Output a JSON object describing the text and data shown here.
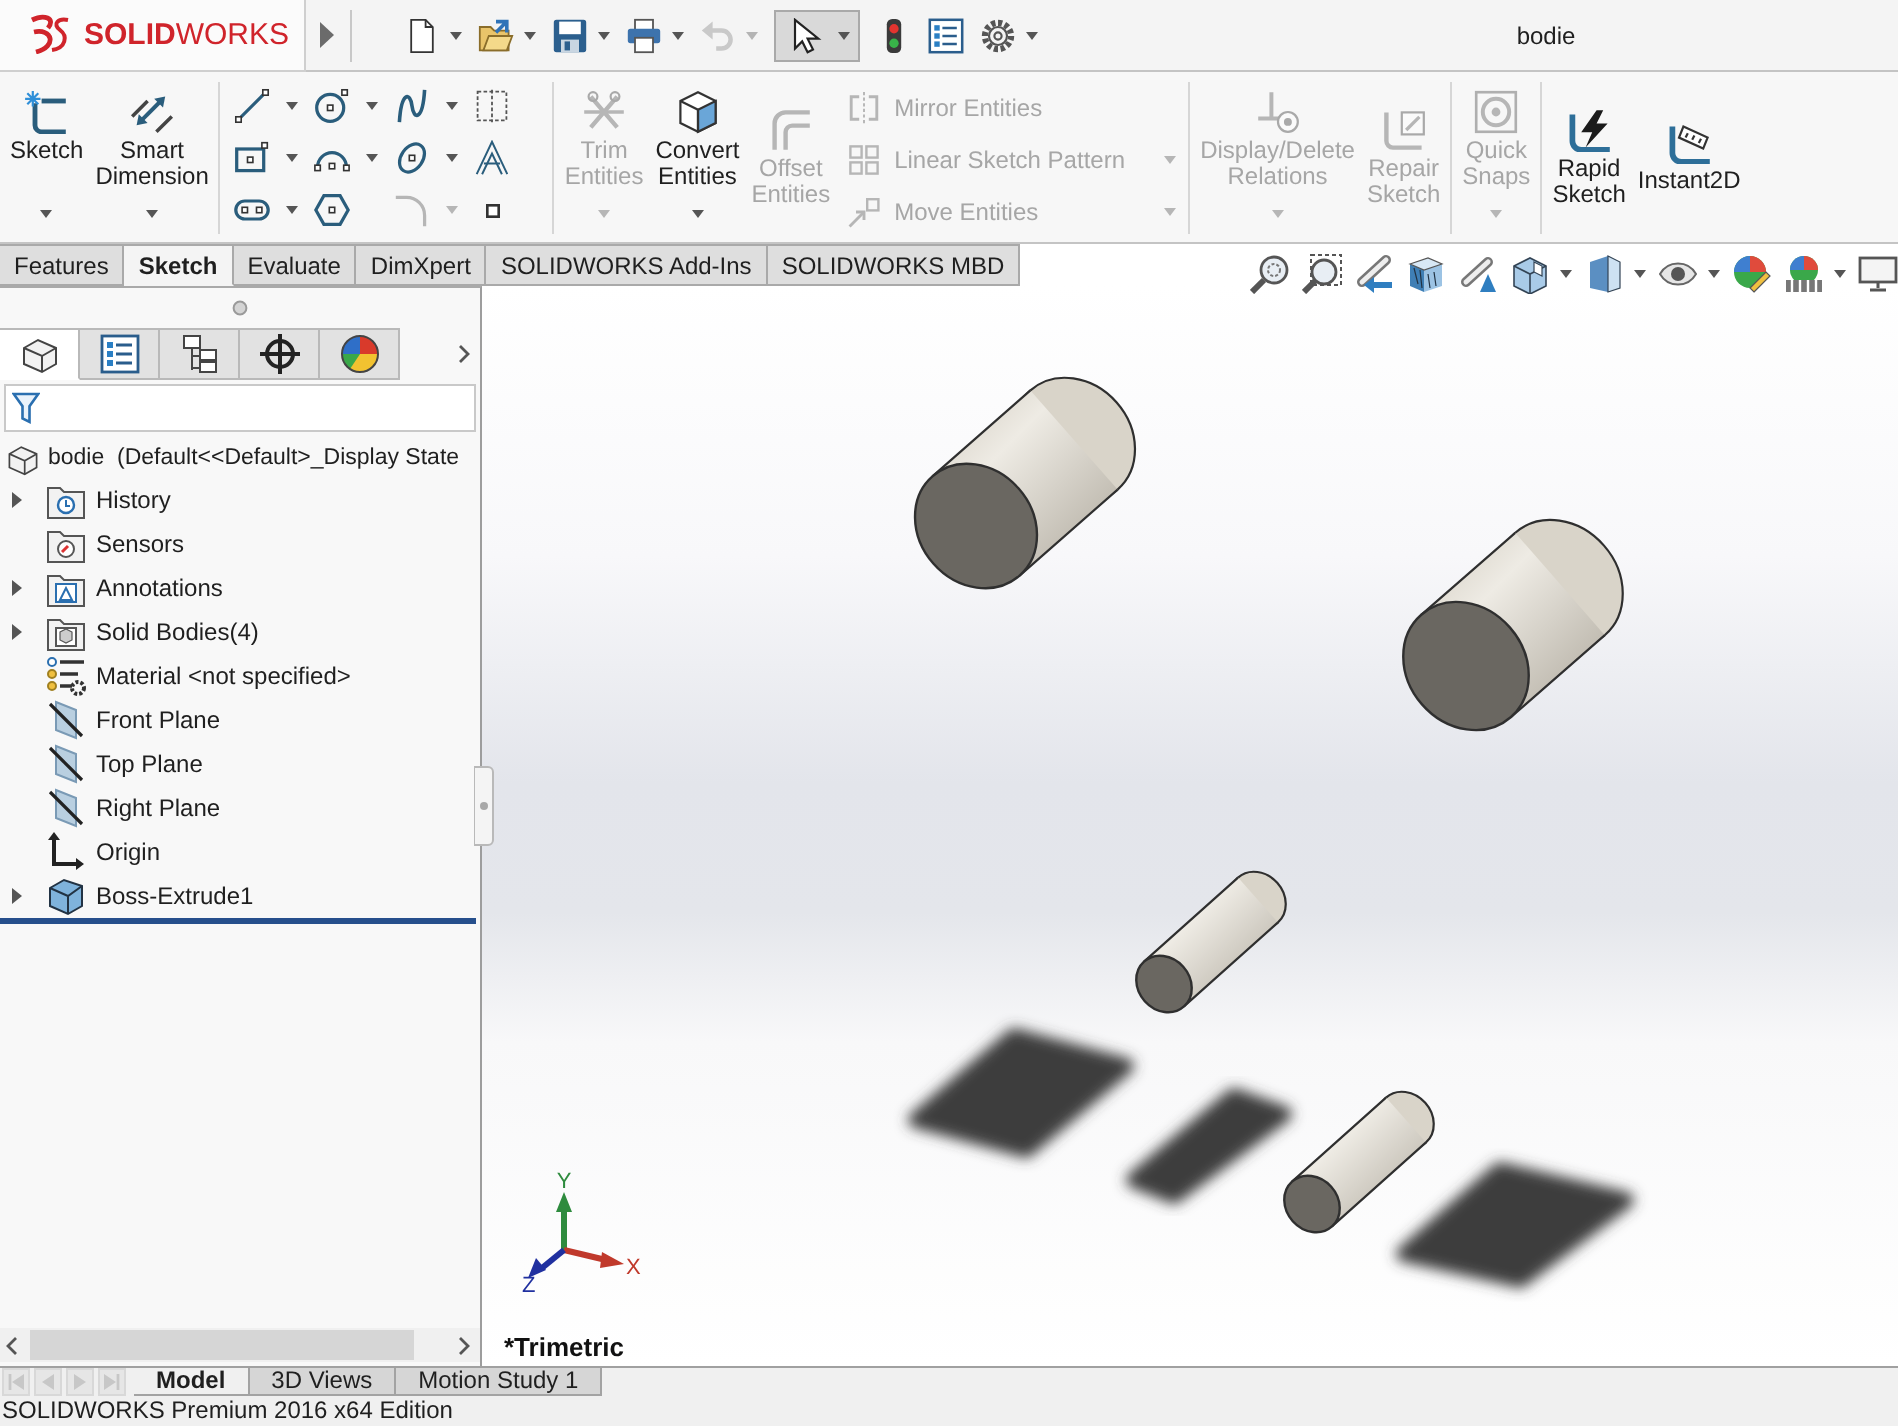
{
  "title_bar": {
    "logo": "**SOLID**WORKS",
    "quick_access": [
      {
        "kind": "new",
        "dropdown": true,
        "disabled": false,
        "pressed": false
      },
      {
        "kind": "open",
        "dropdown": true,
        "disabled": false,
        "pressed": false
      },
      {
        "kind": "save",
        "dropdown": true,
        "disabled": false,
        "pressed": false
      },
      {
        "kind": "print",
        "dropdown": true,
        "disabled": false,
        "pressed": false
      },
      {
        "kind": "undo",
        "dropdown": true,
        "disabled": true,
        "pressed": false
      },
      {
        "kind": "select",
        "dropdown": true,
        "disabled": false,
        "pressed": true
      },
      {
        "kind": "rebuild",
        "dropdown": false,
        "disabled": false,
        "pressed": false
      },
      {
        "kind": "file-properties",
        "dropdown": false,
        "disabled": false,
        "pressed": false
      },
      {
        "kind": "options",
        "dropdown": true,
        "disabled": false,
        "pressed": false
      }
    ],
    "document_title": "bodie"
  },
  "ribbon": {
    "groups": [
      {
        "buttons": [
          {
            "kind": "sketch",
            "label": "Sketch",
            "dropdown": true,
            "disabled": false
          },
          {
            "kind": "smart-dimension",
            "label": "Smart Dimension",
            "dropdown": true,
            "disabled": false
          }
        ]
      },
      {
        "grid": [
          {
            "kind": "line",
            "dropdown": true,
            "disabled": false
          },
          {
            "kind": "circle",
            "dropdown": true,
            "disabled": false
          },
          {
            "kind": "spline",
            "dropdown": true,
            "disabled": false
          },
          {
            "kind": "construction",
            "dropdown": false,
            "disabled": false
          },
          {
            "kind": "rectangle",
            "dropdown": true,
            "disabled": false
          },
          {
            "kind": "arc",
            "dropdown": true,
            "disabled": false
          },
          {
            "kind": "ellipse",
            "dropdown": true,
            "disabled": false
          },
          {
            "kind": "text",
            "dropdown": false,
            "disabled": false
          },
          {
            "kind": "slot",
            "dropdown": true,
            "disabled": false
          },
          {
            "kind": "polygon",
            "dropdown": false,
            "disabled": false
          },
          {
            "kind": "fillet",
            "dropdown": true,
            "disabled": true
          },
          {
            "kind": "point",
            "dropdown": false,
            "disabled": false
          }
        ]
      },
      {
        "buttons": [
          {
            "kind": "trim-entities",
            "label": "Trim Entities",
            "dropdown": true,
            "disabled": true
          },
          {
            "kind": "convert-entities",
            "label": "Convert Entities",
            "dropdown": true,
            "disabled": false
          },
          {
            "kind": "offset-entities",
            "label": "Offset Entities",
            "dropdown": false,
            "disabled": true
          }
        ],
        "list": [
          {
            "kind": "mirror-entities",
            "label": "Mirror Entities",
            "dropdown": false,
            "disabled": true
          },
          {
            "kind": "linear-sketch-pattern",
            "label": "Linear Sketch Pattern",
            "dropdown": true,
            "disabled": true
          },
          {
            "kind": "move-entities",
            "label": "Move Entities",
            "dropdown": true,
            "disabled": true
          }
        ]
      },
      {
        "buttons": [
          {
            "kind": "display-delete-relations",
            "label": "Display/Delete Relations",
            "dropdown": true,
            "disabled": true
          },
          {
            "kind": "repair-sketch",
            "label": "Repair Sketch",
            "dropdown": false,
            "disabled": true
          }
        ]
      },
      {
        "buttons": [
          {
            "kind": "quick-snaps",
            "label": "Quick Snaps",
            "dropdown": true,
            "disabled": true
          }
        ]
      },
      {
        "buttons": [
          {
            "kind": "rapid-sketch",
            "label": "Rapid Sketch",
            "dropdown": false,
            "disabled": false
          },
          {
            "kind": "instant2d",
            "label": "Instant2D",
            "dropdown": false,
            "disabled": false
          }
        ]
      }
    ]
  },
  "command_tabs": [
    {
      "label": "Features",
      "selected": false
    },
    {
      "label": "Sketch",
      "selected": true
    },
    {
      "label": "Evaluate",
      "selected": false
    },
    {
      "label": "DimXpert",
      "selected": false
    },
    {
      "label": "SOLIDWORKS Add-Ins",
      "selected": false
    },
    {
      "label": "SOLIDWORKS MBD",
      "selected": false
    }
  ],
  "view_toolbar": [
    {
      "kind": "zoom-to-fit",
      "dropdown": false
    },
    {
      "kind": "zoom-to-area",
      "dropdown": false
    },
    {
      "kind": "previous-view",
      "dropdown": false
    },
    {
      "kind": "section-view",
      "dropdown": false
    },
    {
      "kind": "dynamic-annotation",
      "dropdown": false
    },
    {
      "kind": "view-orientation",
      "dropdown": true
    },
    {
      "kind": "display-style",
      "dropdown": true
    },
    {
      "kind": "hide-show",
      "dropdown": true
    },
    {
      "kind": "edit-appearance",
      "dropdown": false
    },
    {
      "kind": "apply-scene",
      "dropdown": true
    },
    {
      "kind": "view-settings",
      "dropdown": false
    }
  ],
  "manager_tabs": [
    {
      "kind": "feature-manager",
      "selected": true
    },
    {
      "kind": "property-manager",
      "selected": false
    },
    {
      "kind": "configuration-manager",
      "selected": false
    },
    {
      "kind": "dimxpert-manager",
      "selected": false
    },
    {
      "kind": "display-manager",
      "selected": false
    }
  ],
  "feature_tree": {
    "root": {
      "kind": "part",
      "label": "bodie  (Default<<Default>_Display State",
      "children": [
        {
          "kind": "history",
          "label": "History",
          "expandable": true
        },
        {
          "kind": "sensors",
          "label": "Sensors",
          "expandable": false
        },
        {
          "kind": "annotations",
          "label": "Annotations",
          "expandable": true
        },
        {
          "kind": "solid-bodies",
          "label": "Solid Bodies(4)",
          "expandable": true
        },
        {
          "kind": "material",
          "label": "Material <not specified>",
          "expandable": false
        },
        {
          "kind": "plane",
          "label": "Front Plane",
          "expandable": false
        },
        {
          "kind": "plane",
          "label": "Top Plane",
          "expandable": false
        },
        {
          "kind": "plane",
          "label": "Right Plane",
          "expandable": false
        },
        {
          "kind": "origin",
          "label": "Origin",
          "expandable": false
        },
        {
          "kind": "extrude",
          "label": "Boss-Extrude1",
          "expandable": true
        }
      ]
    }
  },
  "viewport": {
    "view_name": "*Trimetric",
    "triad": {
      "x": "X",
      "y": "Y",
      "z": "Z"
    }
  },
  "bottom_tabs": {
    "navigation": [
      {
        "kind": "first",
        "disabled": true
      },
      {
        "kind": "previous",
        "disabled": true
      },
      {
        "kind": "next",
        "disabled": true
      },
      {
        "kind": "last",
        "disabled": true
      }
    ],
    "tabs": [
      {
        "label": "Model",
        "selected": true
      },
      {
        "label": "3D Views",
        "selected": false
      },
      {
        "label": "Motion Study 1",
        "selected": false
      }
    ]
  },
  "status_bar": {
    "text": "SOLIDWORKS Premium 2016 x64 Edition"
  }
}
